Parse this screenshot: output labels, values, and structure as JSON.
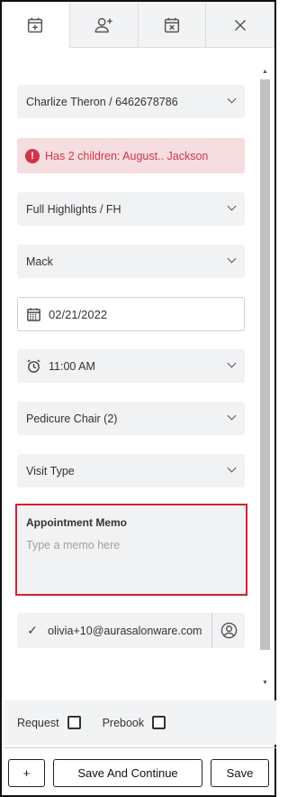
{
  "tabs": [
    {
      "icon": "calendar-plus-icon",
      "active": true
    },
    {
      "icon": "add-user-icon",
      "active": false
    },
    {
      "icon": "calendar-x-icon",
      "active": false
    },
    {
      "icon": "close-icon",
      "active": false
    }
  ],
  "form": {
    "client": "Charlize Theron / 6462678786",
    "alert": "Has 2 children: August.. Jackson",
    "service": "Full Highlights / FH",
    "stylist": "Mack",
    "date": "02/21/2022",
    "time": "11:00 AM",
    "resource": "Pedicure Chair (2)",
    "visit_type": "Visit Type",
    "memo_label": "Appointment Memo",
    "memo_placeholder": "Type a memo here",
    "memo_value": "",
    "email": "olivia+10@aurasalonware.com"
  },
  "options": {
    "request_label": "Request",
    "request_checked": false,
    "prebook_label": "Prebook",
    "prebook_checked": false
  },
  "footer": {
    "add_label": "+",
    "save_continue_label": "Save And Continue",
    "save_label": "Save"
  },
  "colors": {
    "accent_red": "#d3232f",
    "alert_bg": "#f6dde0",
    "alert_text": "#d0364a",
    "field_bg": "#f1f2f4"
  }
}
